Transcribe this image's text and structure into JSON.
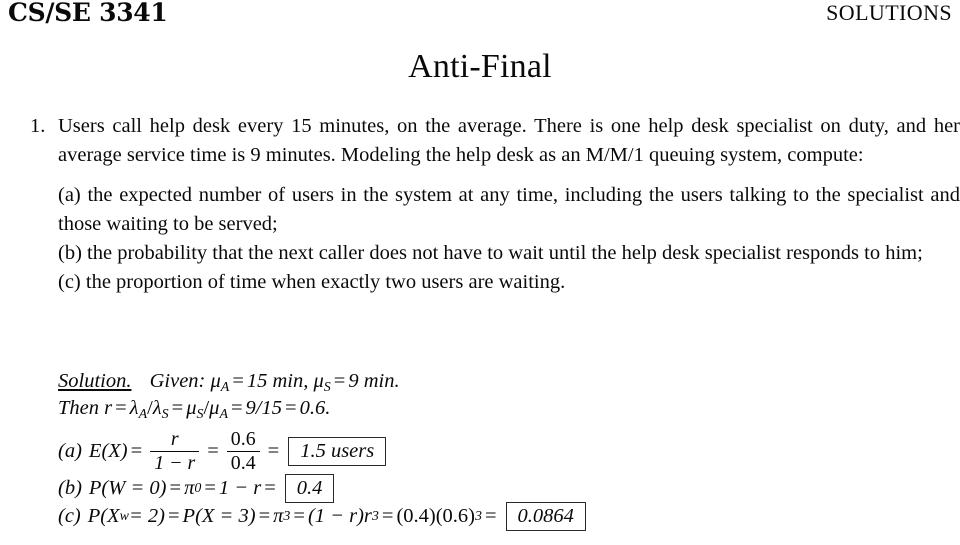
{
  "header": {
    "course_code": "CS/SE 3341",
    "doc_kind": "SOLUTIONS"
  },
  "title": "Anti-Final",
  "problem": {
    "number": "1.",
    "statement": "Users call help desk every 15 minutes, on the average. There is one help desk specialist on duty, and her average service time is 9 minutes. Modeling the help desk as an M/M/1 queuing system, compute:",
    "parts": [
      {
        "tag": "(a)",
        "text": "the expected number of users in the system at any time, including the users talking to the specialist and those waiting to be served;"
      },
      {
        "tag": "(b)",
        "text": "the probability that the next caller does not have to wait until the help desk specialist responds to him;"
      },
      {
        "tag": "(c)",
        "text": "the proportion of time when exactly two users are waiting."
      }
    ]
  },
  "solution": {
    "label": "Solution.",
    "given_word": "Given:",
    "given": {
      "mu_a_symbol": "μ",
      "mu_a_sub": "A",
      "mu_a_value": "15",
      "unit": "min",
      "mu_s_symbol": "μ",
      "mu_s_sub": "S",
      "mu_s_value": "9",
      "unit_end": "min."
    },
    "then_line": {
      "then_word": "Then",
      "r": "r",
      "lambda": "λ",
      "lambda_a_sub": "A",
      "lambda_s_sub": "S",
      "mu": "μ",
      "mu_s_sub": "S",
      "mu_a_sub": "A",
      "ratio": "9/15",
      "value": "0.6."
    },
    "answers": [
      {
        "tag": "(a)",
        "lhs": "E",
        "lhs_arg": "(X)",
        "frac1_num": "r",
        "frac1_den": "1 − r",
        "frac2_num": "0.6",
        "frac2_den": "0.4",
        "boxed": "1.5 users"
      },
      {
        "tag": "(b)",
        "lhs": "P(W = 0)",
        "pi": "π",
        "pi_sub": "0",
        "expr": "1 − r",
        "boxed": "0.4"
      },
      {
        "tag": "(c)",
        "lhs": "P(X",
        "lhs_sub": "w",
        "lhs_rest": "= 2)",
        "mid": "P(X = 3)",
        "pi": "π",
        "pi_sub": "3",
        "expr_base": "(1 − r)r",
        "expr_sup": "3",
        "numeric_base": "(0.4)(0.6)",
        "numeric_sup": "3",
        "boxed": "0.0864"
      }
    ]
  },
  "symbols": {
    "equals": "=",
    "comma": ","
  }
}
